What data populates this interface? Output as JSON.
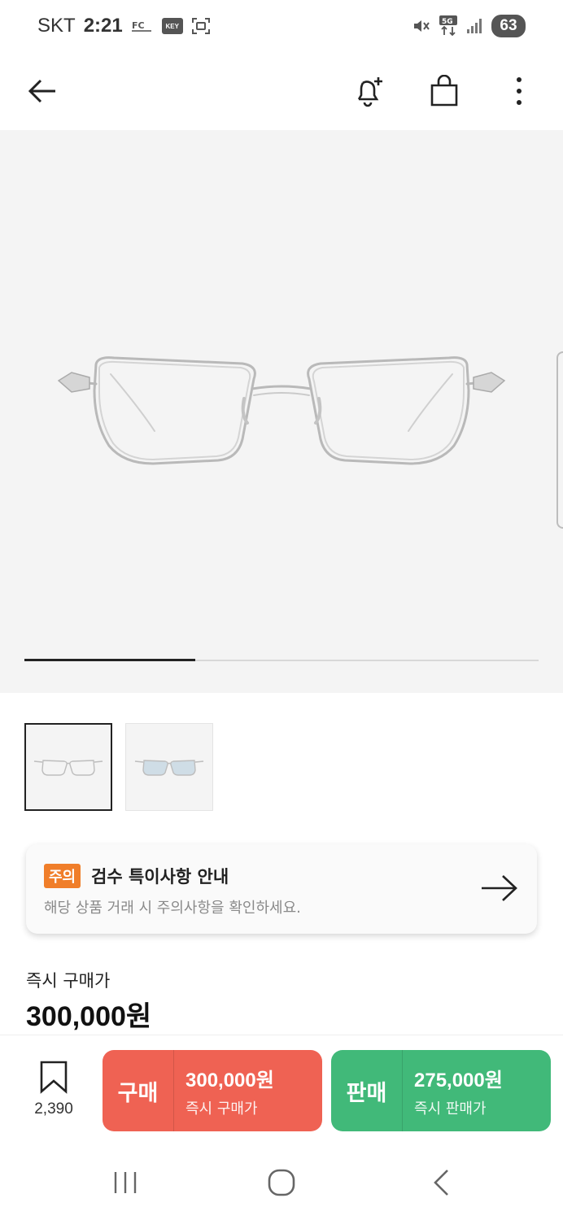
{
  "status_bar": {
    "carrier": "SKT",
    "time": "2:21",
    "key_badge": "KEY",
    "network": "5G",
    "battery": "63"
  },
  "nav": {
    "icons": [
      "back-arrow-icon",
      "bell-plus-icon",
      "shopping-bag-icon",
      "more-vert-icon"
    ]
  },
  "gallery": {
    "progress": 0.333,
    "thumbnails": [
      "silver-glasses",
      "blue-lens-glasses"
    ],
    "selected_index": 0
  },
  "notice": {
    "badge": "주의",
    "title": "검수 특이사항 안내",
    "subtitle": "해당 상품 거래 시 주의사항을 확인하세요."
  },
  "price": {
    "label": "즉시 구매가",
    "value": "300,000원"
  },
  "bottom_bar": {
    "wish_count": "2,390",
    "buy": {
      "label": "구매",
      "price": "300,000원",
      "sub": "즉시 구매가"
    },
    "sell": {
      "label": "판매",
      "price": "275,000원",
      "sub": "즉시 판매가"
    }
  },
  "colors": {
    "buy": "#ef6253",
    "sell": "#41b979",
    "notice_badge": "#f07e2a",
    "image_bg": "#f4f4f4"
  }
}
